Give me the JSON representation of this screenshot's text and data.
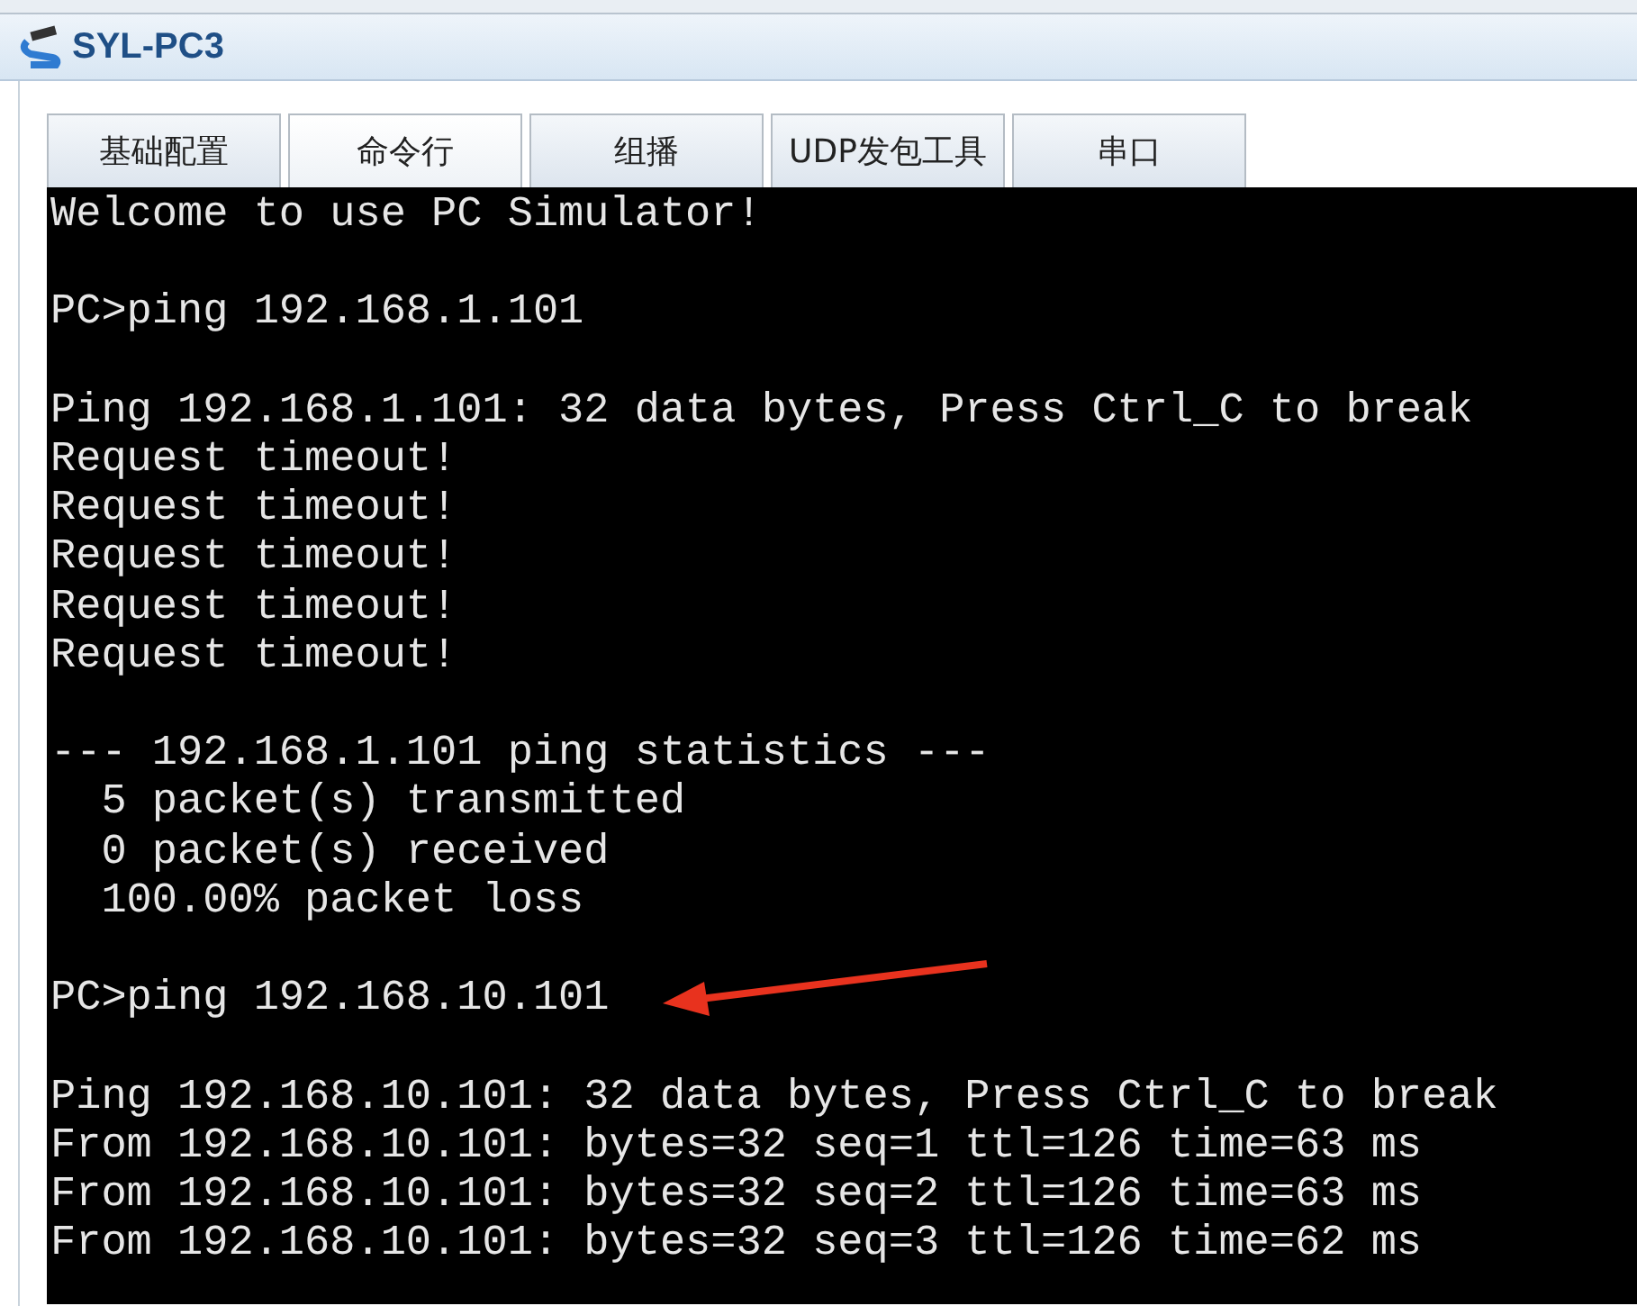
{
  "window": {
    "title": "SYL-PC3"
  },
  "tabs": [
    {
      "label": "基础配置",
      "selected": false
    },
    {
      "label": "命令行",
      "selected": true
    },
    {
      "label": "组播",
      "selected": false
    },
    {
      "label": "UDP发包工具",
      "selected": false
    },
    {
      "label": "串口",
      "selected": false
    }
  ],
  "console": {
    "blocks": [
      [
        "Welcome to use PC Simulator!"
      ],
      [
        "PC>ping 192.168.1.101"
      ],
      [
        "Ping 192.168.1.101: 32 data bytes, Press Ctrl_C to break",
        "Request timeout!",
        "Request timeout!",
        "Request timeout!",
        "Request timeout!",
        "Request timeout!"
      ],
      [
        "--- 192.168.1.101 ping statistics ---",
        "  5 packet(s) transmitted",
        "  0 packet(s) received",
        "  100.00% packet loss"
      ],
      [
        "PC>ping 192.168.10.101"
      ],
      [
        "Ping 192.168.10.101: 32 data bytes, Press Ctrl_C to break",
        "From 192.168.10.101: bytes=32 seq=1 ttl=126 time=63 ms",
        "From 192.168.10.101: bytes=32 seq=2 ttl=126 time=63 ms",
        "From 192.168.10.101: bytes=32 seq=3 ttl=126 time=62 ms"
      ]
    ]
  }
}
